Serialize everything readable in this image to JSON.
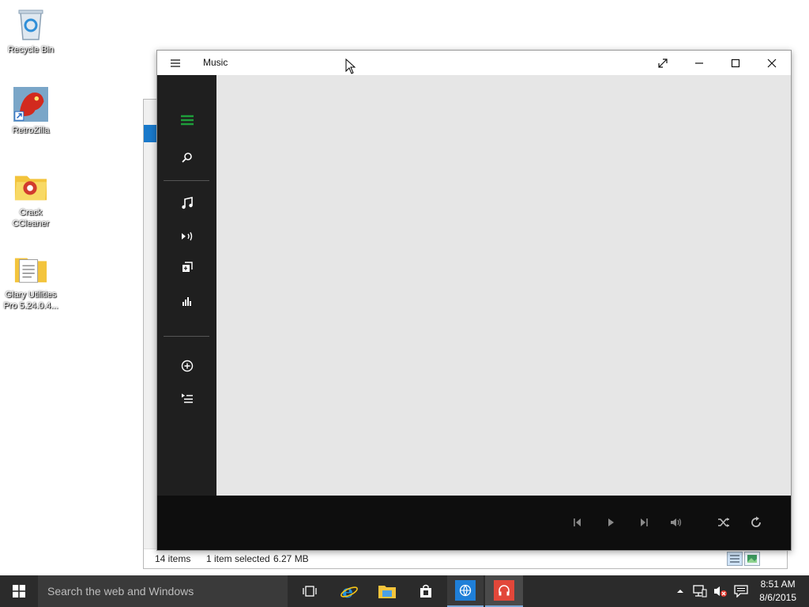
{
  "desktop": {
    "icons": [
      {
        "label": "Recycle Bin"
      },
      {
        "label": "RetroZilla"
      },
      {
        "label": "Crack CCleaner"
      },
      {
        "label": "Glary Utilities Pro 5.24.0.4..."
      }
    ]
  },
  "music_window": {
    "title": "Music",
    "sidebar": [
      "menu-icon",
      "search-icon",
      "music-note-icon",
      "now-playing-icon",
      "albums-icon",
      "charts-icon",
      "add-icon",
      "playlist-icon"
    ]
  },
  "explorer_window": {
    "status": {
      "items": "14 items",
      "selected": "1 item selected",
      "size": "6.27 MB"
    }
  },
  "taskbar": {
    "search_placeholder": "Search the web and Windows",
    "time": "8:51 AM",
    "date": "8/6/2015"
  },
  "colors": {
    "accent_green": "#1e9e3a",
    "taskbar": "#2b2b2b",
    "sidebar": "#1f1f1f",
    "playbar": "#0e0e0e"
  }
}
